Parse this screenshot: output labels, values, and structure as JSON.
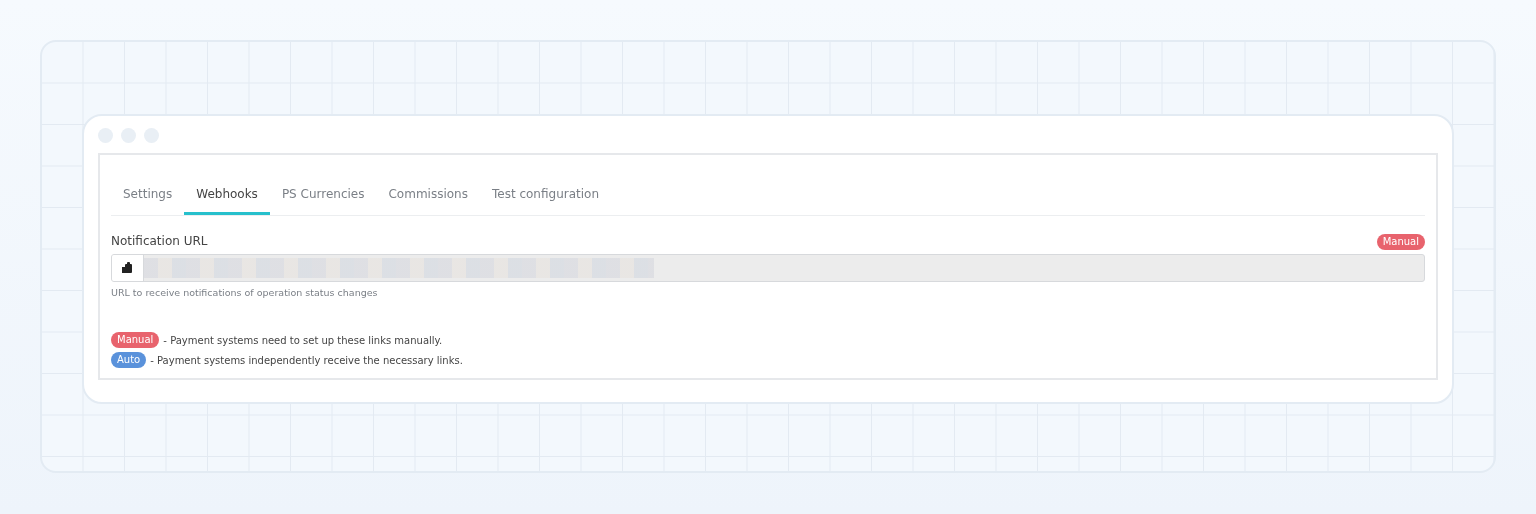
{
  "tabs": [
    {
      "label": "Settings",
      "selected": false
    },
    {
      "label": "Webhooks",
      "selected": true
    },
    {
      "label": "PS Currencies",
      "selected": false
    },
    {
      "label": "Commissions",
      "selected": false
    },
    {
      "label": "Test configuration",
      "selected": false
    }
  ],
  "field": {
    "label": "Notification URL",
    "badge": {
      "text": "Manual",
      "color": "#e8636d"
    },
    "disabled": true,
    "help": "URL to receive notifications of operation status changes"
  },
  "legend": [
    {
      "badge": "Manual",
      "color": "#e8636d",
      "text": "- Payment systems need to set up these links manually."
    },
    {
      "badge": "Auto",
      "color": "#5a92db",
      "text": "- Payment systems independently receive the necessary links."
    }
  ]
}
